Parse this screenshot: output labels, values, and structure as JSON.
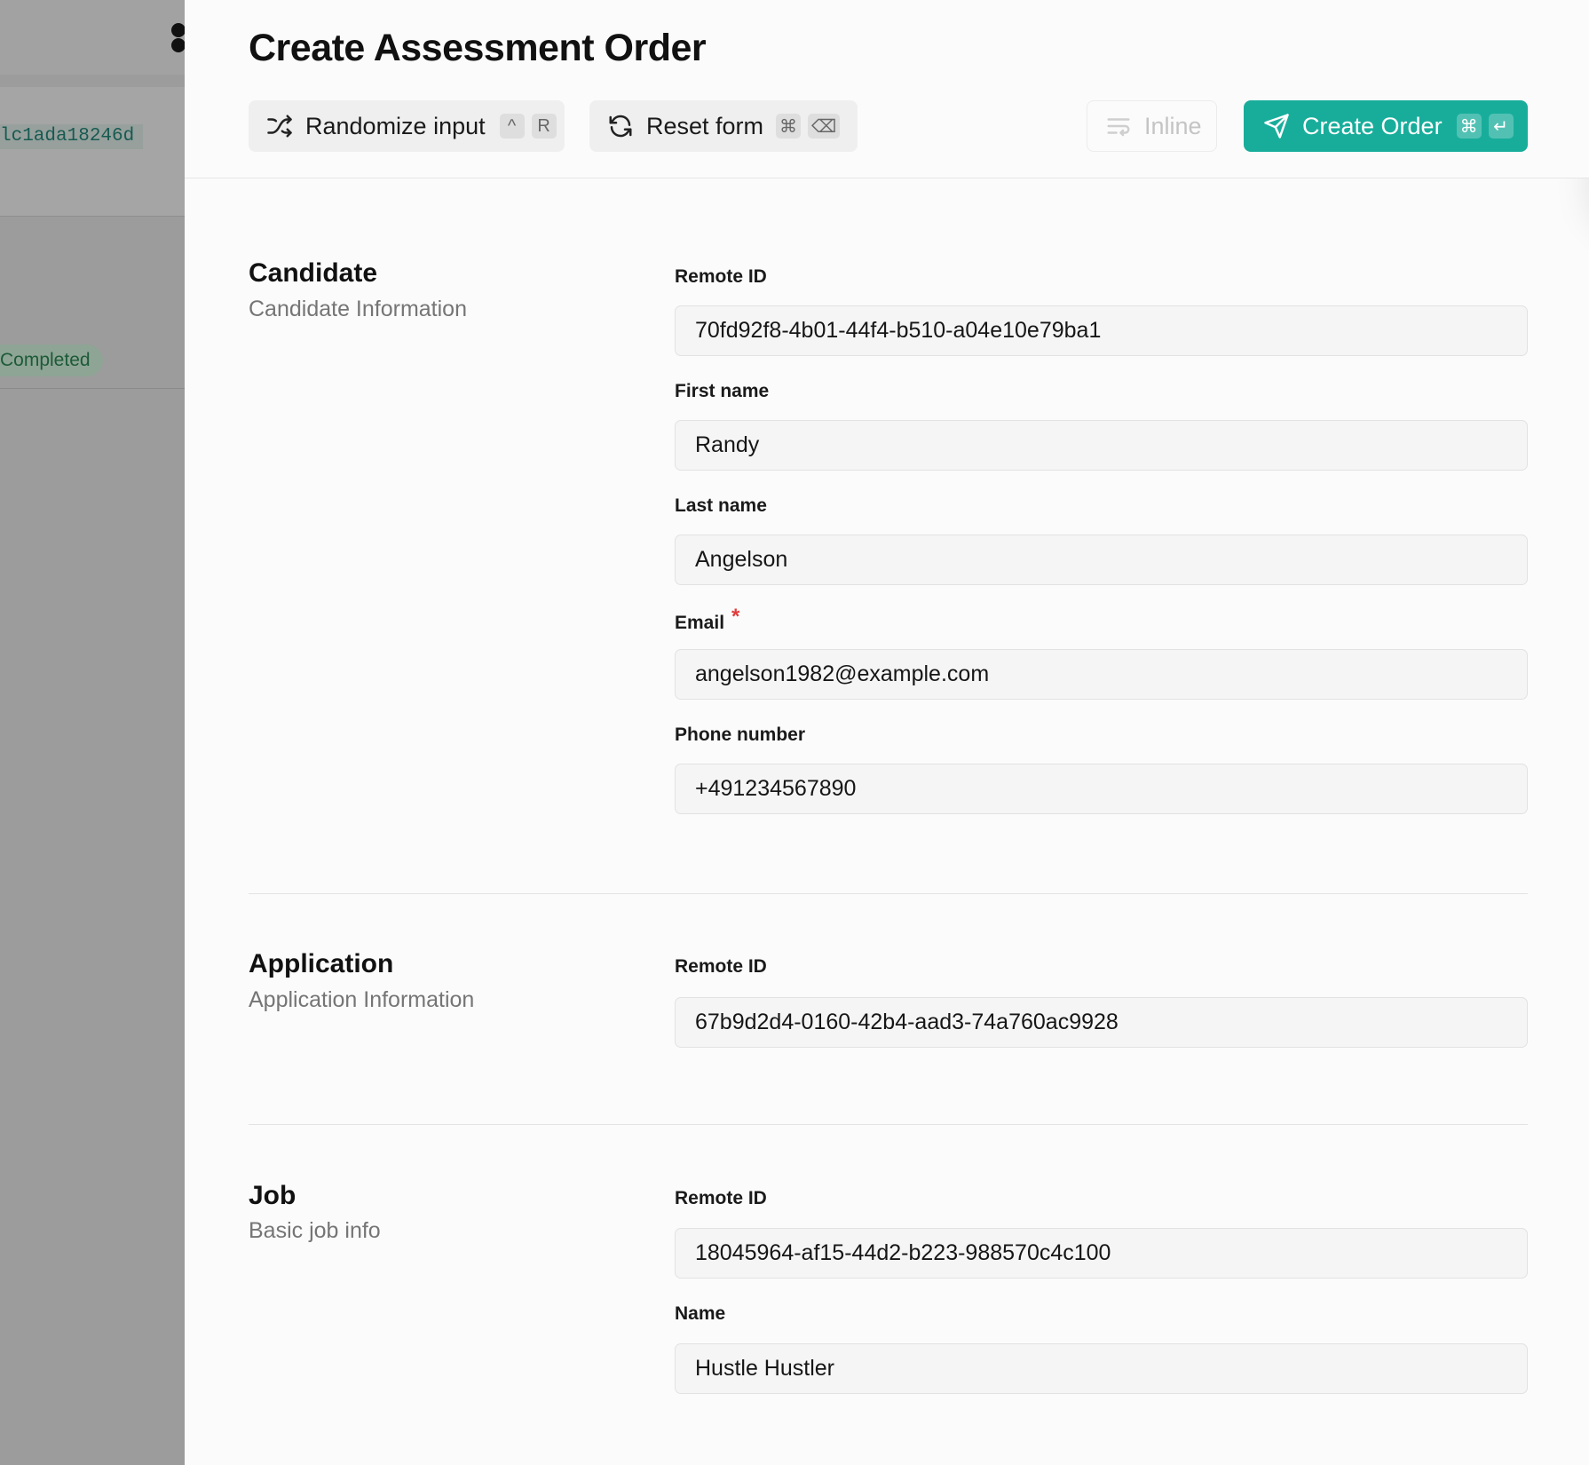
{
  "background": {
    "id_fragment": "lc1ada18246d",
    "status_badge": "Completed"
  },
  "header": {
    "title": "Create Assessment Order",
    "randomize": {
      "label": "Randomize input",
      "keys": [
        "^",
        "R"
      ]
    },
    "reset": {
      "label": "Reset form",
      "keys": [
        "⌘",
        "⌫"
      ]
    },
    "inline": {
      "label": "Inline"
    },
    "create": {
      "label": "Create Order",
      "keys": [
        "⌘",
        "↵"
      ]
    }
  },
  "sections": {
    "candidate": {
      "title": "Candidate",
      "subtitle": "Candidate Information",
      "fields": {
        "remote_id": {
          "label": "Remote ID",
          "value": "70fd92f8-4b01-44f4-b510-a04e10e79ba1"
        },
        "first_name": {
          "label": "First name",
          "value": "Randy"
        },
        "last_name": {
          "label": "Last name",
          "value": "Angelson"
        },
        "email": {
          "label": "Email",
          "required_mark": "*",
          "value": "angelson1982@example.com"
        },
        "phone": {
          "label": "Phone number",
          "value": "+491234567890"
        }
      }
    },
    "application": {
      "title": "Application",
      "subtitle": "Application Information",
      "fields": {
        "remote_id": {
          "label": "Remote ID",
          "value": "67b9d2d4-0160-42b4-aad3-74a760ac9928"
        }
      }
    },
    "job": {
      "title": "Job",
      "subtitle": "Basic job info",
      "fields": {
        "remote_id": {
          "label": "Remote ID",
          "value": "18045964-af15-44d2-b223-988570c4c100"
        },
        "name": {
          "label": "Name",
          "value": "Hustle Hustler"
        }
      }
    }
  },
  "colors": {
    "accent": "#18ad9b",
    "required": "#e03c3c",
    "overlay": "#9c9c9c"
  }
}
